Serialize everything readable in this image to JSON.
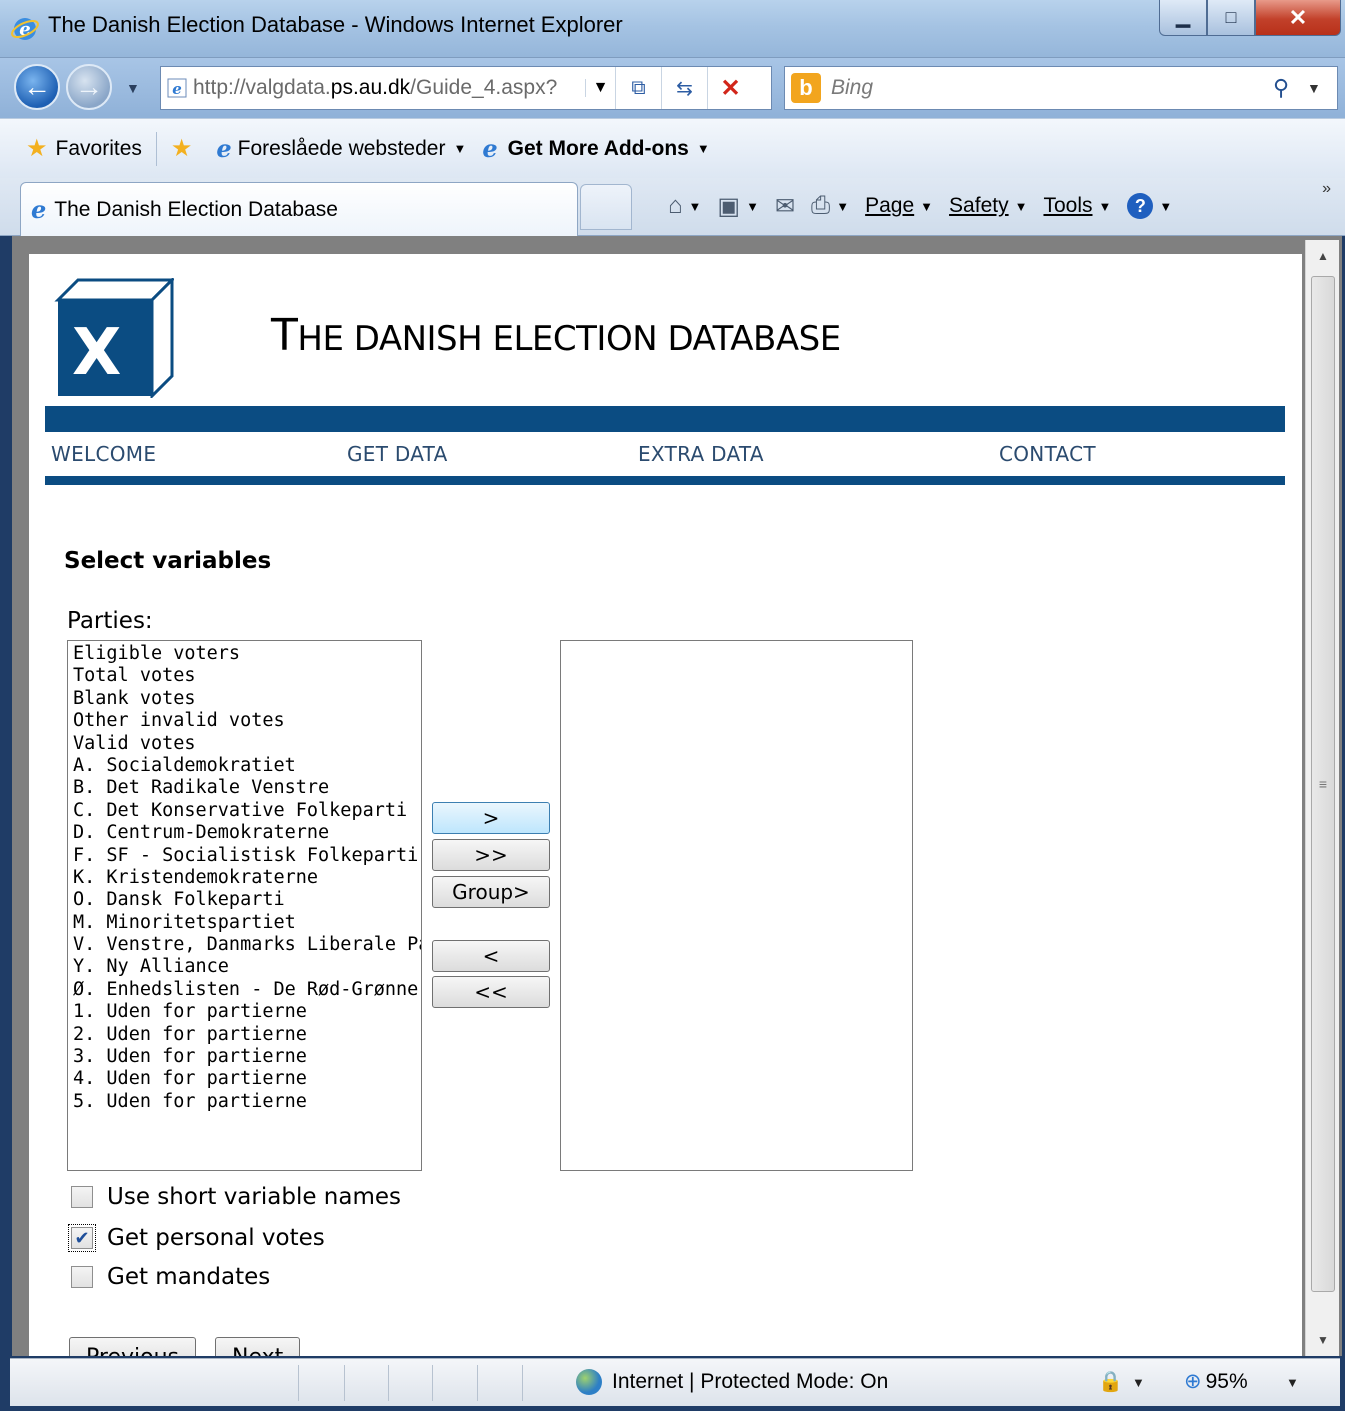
{
  "window": {
    "title": "The Danish Election Database - Windows Internet Explorer",
    "minimize": "▁",
    "maximize": "□",
    "close": "✕"
  },
  "address_bar": {
    "url_prefix": "http://valgdata.",
    "url_domain": "ps.au.dk",
    "url_suffix": "/Guide_4.aspx?",
    "search_placeholder": "Bing"
  },
  "favorites_bar": {
    "favorites_label": "Favorites",
    "suggested_sites": "Foreslåede websteder",
    "add_ons": "Get More Add-ons"
  },
  "tabs": {
    "active_tab_title": "The Danish Election Database"
  },
  "command_bar": {
    "page": "Page",
    "safety": "Safety",
    "tools": "Tools",
    "help": "?",
    "overflow": "»"
  },
  "site": {
    "logo_letter": "X",
    "title_first": "T",
    "title_rest": "HE DANISH ELECTION DATABASE",
    "menu": [
      "WELCOME",
      "GET DATA",
      "EXTRA DATA",
      "CONTACT"
    ]
  },
  "form": {
    "heading": "Select variables",
    "parties_label": "Parties:",
    "available": [
      "Eligible voters",
      "Total votes",
      "Blank votes",
      "Other invalid votes",
      "Valid votes",
      "A. Socialdemokratiet",
      "B. Det Radikale Venstre",
      "C. Det Konservative Folkeparti",
      "D. Centrum-Demokraterne",
      "F. SF - Socialistisk Folkeparti",
      "K. Kristendemokraterne",
      "O. Dansk Folkeparti",
      "M. Minoritetspartiet",
      "V. Venstre, Danmarks Liberale Parti",
      "Y. Ny Alliance",
      "Ø. Enhedslisten - De Rød-Grønne",
      "1. Uden for partierne",
      "2. Uden for partierne",
      "3. Uden for partierne",
      "4. Uden for partierne",
      "5. Uden for partierne"
    ],
    "buttons": {
      "add": ">",
      "add_all": ">>",
      "group": "Group>",
      "remove": "<",
      "remove_all": "<<"
    },
    "checkboxes": {
      "short_names": {
        "label": "Use short variable names",
        "checked": false
      },
      "personal_votes": {
        "label": "Get personal votes",
        "checked": true
      },
      "mandates": {
        "label": "Get mandates",
        "checked": false
      }
    },
    "previous": "Previous",
    "next": "Next"
  },
  "status_bar": {
    "zone": "Internet | Protected Mode: On",
    "zoom": "95%"
  }
}
